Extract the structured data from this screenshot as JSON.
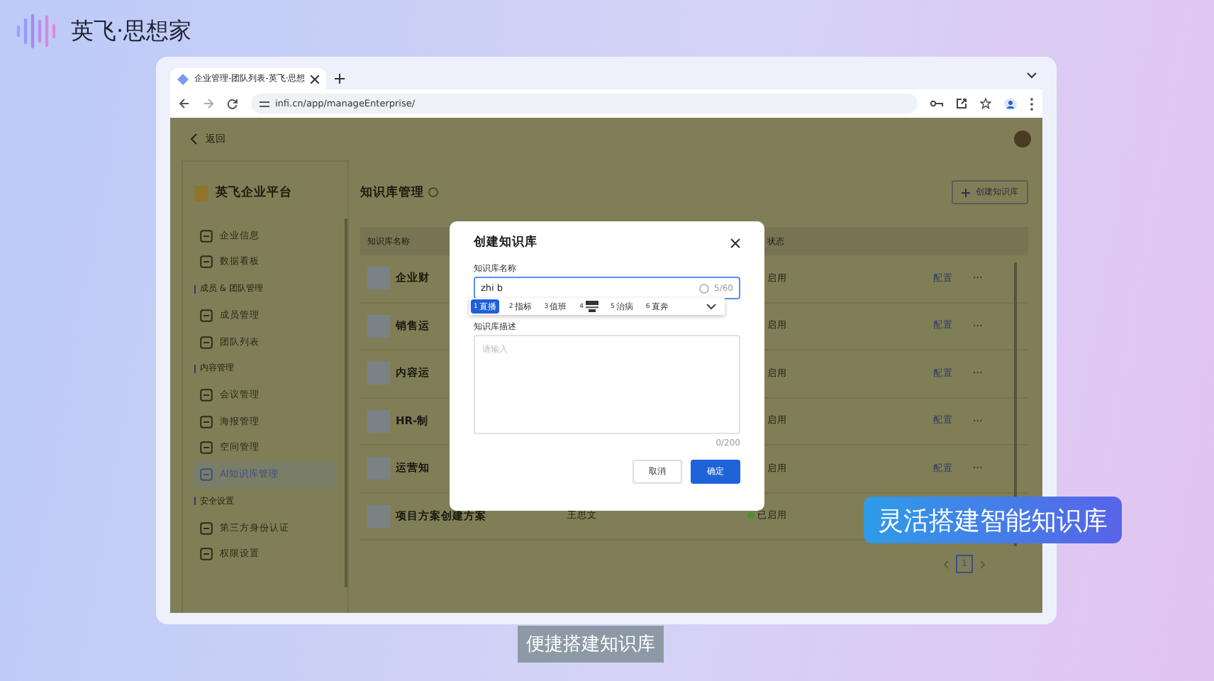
{
  "brand": {
    "name": "英飞·思想家"
  },
  "browser": {
    "tab_title": "企业管理-团队列表-英飞·思想",
    "url": "infi.cn/app/manageEnterprise/"
  },
  "app": {
    "back": "返回",
    "sidebar": {
      "title": "英飞企业平台",
      "entries": [
        {
          "kind": "item",
          "label": "企业信息",
          "selected": false
        },
        {
          "kind": "item",
          "label": "数据看板",
          "selected": false
        },
        {
          "kind": "heading",
          "label": "成员 & 团队管理"
        },
        {
          "kind": "item",
          "label": "成员管理",
          "selected": false
        },
        {
          "kind": "item",
          "label": "团队列表",
          "selected": false
        },
        {
          "kind": "heading",
          "label": "内容管理"
        },
        {
          "kind": "item",
          "label": "会议管理",
          "selected": false
        },
        {
          "kind": "item",
          "label": "海报管理",
          "selected": false
        },
        {
          "kind": "item",
          "label": "空间管理",
          "selected": false
        },
        {
          "kind": "item",
          "label": "AI知识库管理",
          "selected": true
        },
        {
          "kind": "heading",
          "label": "安全设置"
        },
        {
          "kind": "item",
          "label": "第三方身份认证",
          "selected": false
        },
        {
          "kind": "item",
          "label": "权限设置",
          "selected": false
        }
      ]
    },
    "main": {
      "title": "知识库管理",
      "create_button": "创建知识库",
      "table": {
        "columns": [
          "知识库名称",
          "状态"
        ],
        "rows": [
          {
            "name": "企业财",
            "status": "启用",
            "action": "配置",
            "more": "···"
          },
          {
            "name": "销售运",
            "status": "启用",
            "action": "配置",
            "more": "···"
          },
          {
            "name": "内容运",
            "status": "启用",
            "action": "配置",
            "more": "···"
          },
          {
            "name": "HR-制",
            "status": "启用",
            "action": "配置",
            "more": "···"
          },
          {
            "name": "运营知",
            "status": "启用",
            "action": "配置",
            "more": "···"
          },
          {
            "name": "项目方案创建方案",
            "owner": "王思文",
            "status": "已启用",
            "color": "#4f8f2f"
          }
        ]
      },
      "pagination": {
        "pages": [
          {
            "label": "1",
            "selected": true
          }
        ]
      }
    }
  },
  "dialog": {
    "title": "创建知识库",
    "name_label": "知识库名称",
    "name_value": "zhi b",
    "name_count": "5/60",
    "candidates": [
      {
        "kind": "text",
        "index": "1",
        "text": "直播",
        "selected": true
      },
      {
        "kind": "text",
        "index": "2",
        "text": "指标",
        "selected": false
      },
      {
        "kind": "text",
        "index": "3",
        "text": "值班",
        "selected": false
      },
      {
        "kind": "emoji",
        "index": "4",
        "selected": false
      },
      {
        "kind": "text",
        "index": "5",
        "text": "治病",
        "selected": false
      },
      {
        "kind": "text",
        "index": "6",
        "text": "直奔",
        "selected": false
      }
    ],
    "description_label": "知识库描述",
    "description_placeholder": "请输入",
    "description_count": "0/200",
    "buttons": [
      {
        "kind": "secondary",
        "label": "取消"
      },
      {
        "kind": "primary",
        "label": "确定"
      }
    ]
  },
  "captions": [
    {
      "kind": "highlight",
      "text": "灵活搭建智能知识库"
    },
    {
      "kind": "subtitle",
      "text": "便捷搭建知识库"
    }
  ]
}
